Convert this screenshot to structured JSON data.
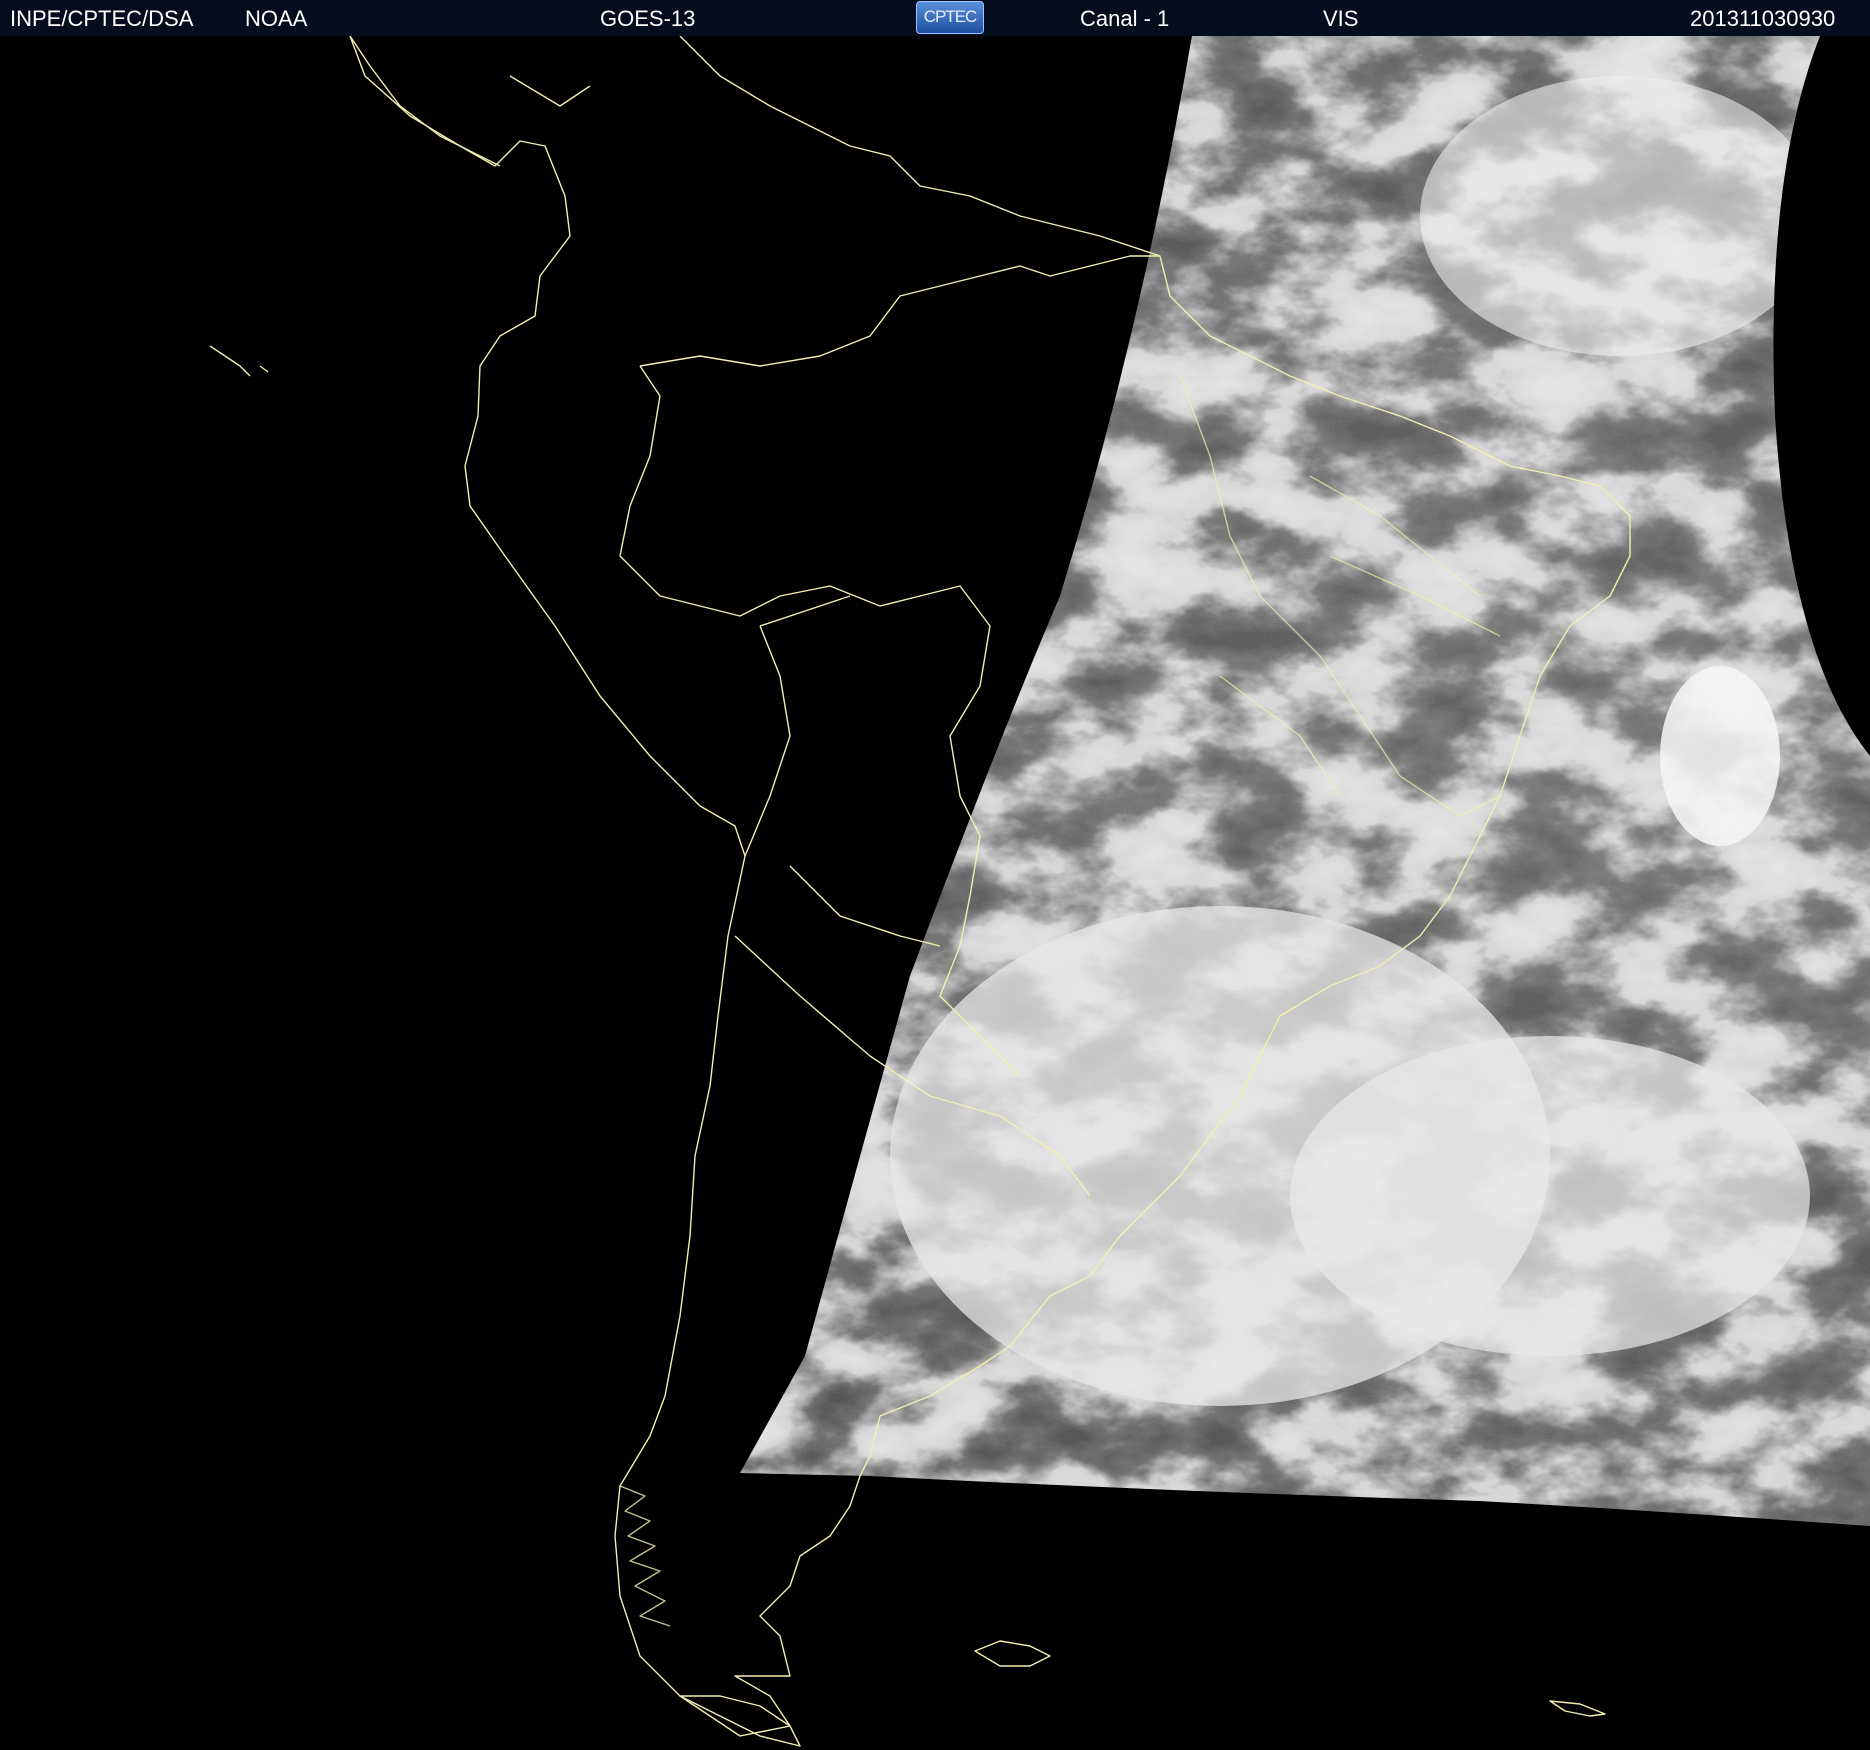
{
  "header": {
    "source": "INPE/CPTEC/DSA",
    "agency": "NOAA",
    "satellite": "GOES-13",
    "logo": "CPTEC",
    "channel": "Canal - 1",
    "band": "VIS",
    "timestamp": "201311030930"
  },
  "colors": {
    "background": "#000000",
    "header_bg": "#030d1d",
    "coastline": "#f2efb0",
    "cloud": "#f3f3f3",
    "clear": "#4e4e4e"
  },
  "map": {
    "region": "South America",
    "coverage": "visible imagery - illuminated sector only"
  }
}
